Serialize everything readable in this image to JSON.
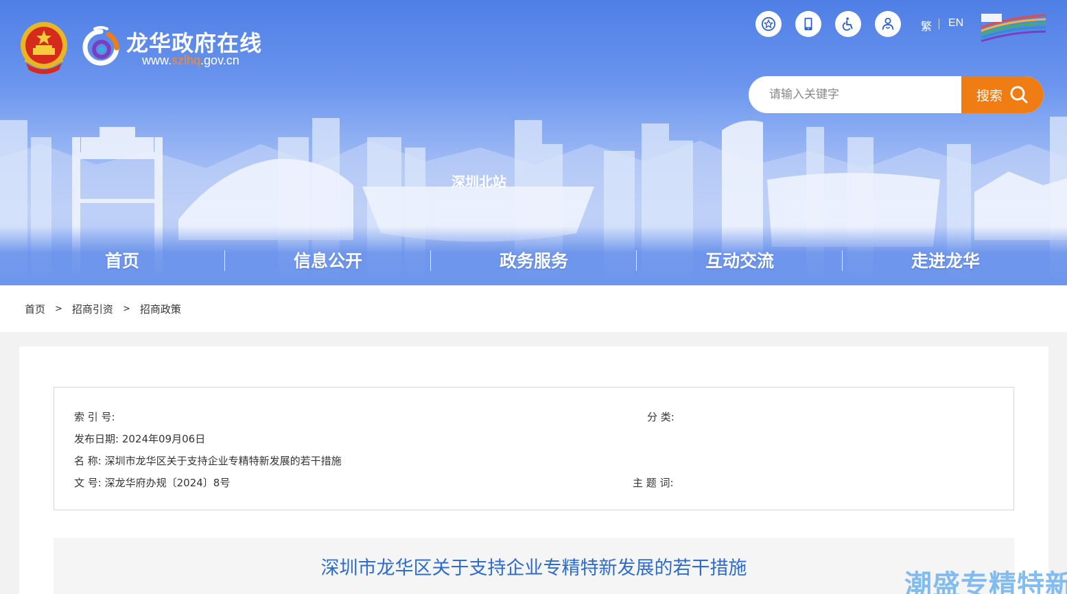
{
  "header": {
    "site_title": "龙华政府在线",
    "site_url_prefix": "www.",
    "site_url_highlight": "szlhq",
    "site_url_suffix": ".gov.cn",
    "tools": [
      {
        "name": "star-badge-icon"
      },
      {
        "name": "mobile-icon"
      },
      {
        "name": "accessibility-icon"
      },
      {
        "name": "elder-care-icon"
      }
    ],
    "lang_traditional": "繁",
    "lang_english": "EN",
    "search": {
      "placeholder": "请输入关键字",
      "button_label": "搜索"
    },
    "skyline_label": "深圳北站"
  },
  "nav": {
    "items": [
      {
        "label": "首页"
      },
      {
        "label": "信息公开"
      },
      {
        "label": "政务服务"
      },
      {
        "label": "互动交流"
      },
      {
        "label": "走进龙华"
      }
    ]
  },
  "breadcrumb": {
    "items": [
      "首页",
      "招商引资",
      "招商政策"
    ],
    "separator": ">"
  },
  "meta": {
    "index_label": "索 引 号:",
    "index_value": "",
    "category_label": "分 类:",
    "category_value": "",
    "date_label": "发布日期:",
    "date_value": "2024年09月06日",
    "name_label": "名 称:",
    "name_value": "深圳市龙华区关于支持企业专精特新发展的若干措施",
    "docno_label": "文 号:",
    "docno_value": "深龙华府办规〔2024〕8号",
    "keyword_label": "主 题 词:",
    "keyword_value": ""
  },
  "document": {
    "title": "深圳市龙华区关于支持企业专精特新发展的若干措施"
  },
  "watermark": "潮盛专精特新",
  "colors": {
    "banner_blue": "#5b87e8",
    "search_orange": "#f07d14",
    "title_blue": "#2d6bd0",
    "url_highlight": "#ff8a1c"
  }
}
